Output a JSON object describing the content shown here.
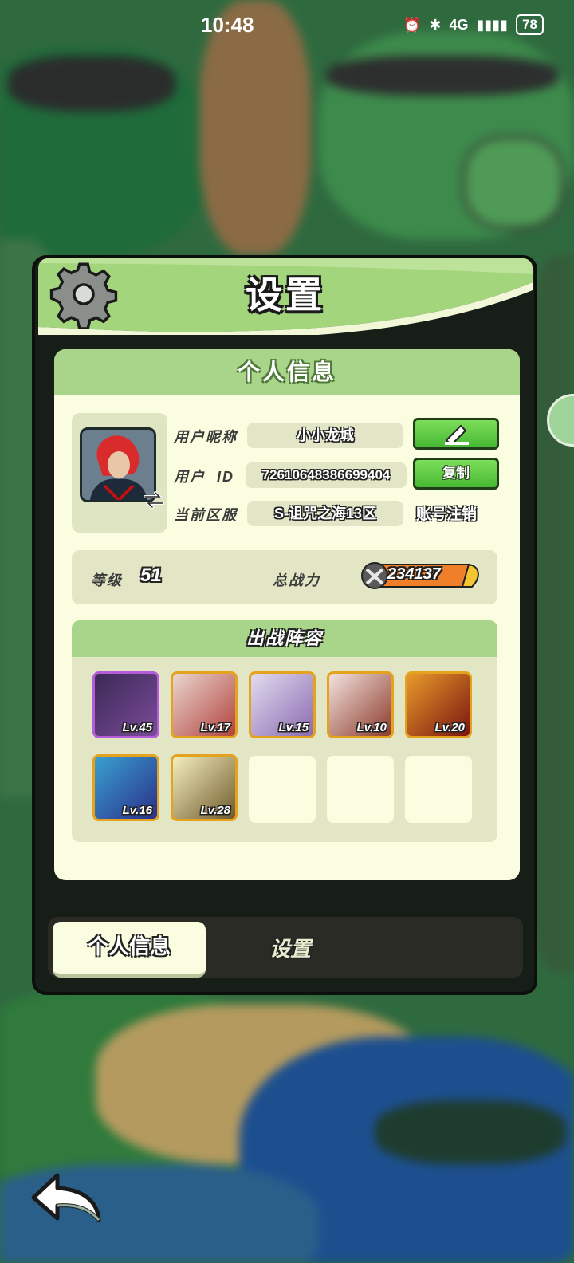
{
  "status_bar": {
    "time": "10:48",
    "network": "4G",
    "battery": "78"
  },
  "dialog": {
    "title": "设置",
    "section_title": "个人信息",
    "profile": {
      "nickname_label": "用户昵称",
      "nickname": "小小龙城",
      "id_label": "用户  ID",
      "user_id": "72610648386699404",
      "server_label": "当前区服",
      "server": "S-诅咒之海13区",
      "edit_icon": "pencil-icon",
      "copy_label": "复制",
      "cancel_account_label": "账号注销"
    },
    "stats": {
      "level_label": "等级",
      "level": "51",
      "power_label": "总战力",
      "power": "234137"
    },
    "lineup": {
      "title": "出战阵容",
      "heroes": [
        {
          "level": "Lv.45",
          "rarity": "purple"
        },
        {
          "level": "Lv.17",
          "rarity": "gold"
        },
        {
          "level": "Lv.15",
          "rarity": "gold"
        },
        {
          "level": "Lv.10",
          "rarity": "gold"
        },
        {
          "level": "Lv.20",
          "rarity": "gold"
        },
        {
          "level": "Lv.16",
          "rarity": "gold"
        },
        {
          "level": "Lv.28",
          "rarity": "gold"
        }
      ],
      "empty_slots": 3
    },
    "tabs": [
      {
        "label": "个人信息",
        "active": true
      },
      {
        "label": "设置",
        "active": false
      }
    ]
  },
  "colors": {
    "panel_bg": "#fbfde1",
    "header_green": "#a9d58a",
    "button_green": "#5ccb43",
    "gold_border": "#e4a21e",
    "purple_border": "#b45bd8"
  }
}
